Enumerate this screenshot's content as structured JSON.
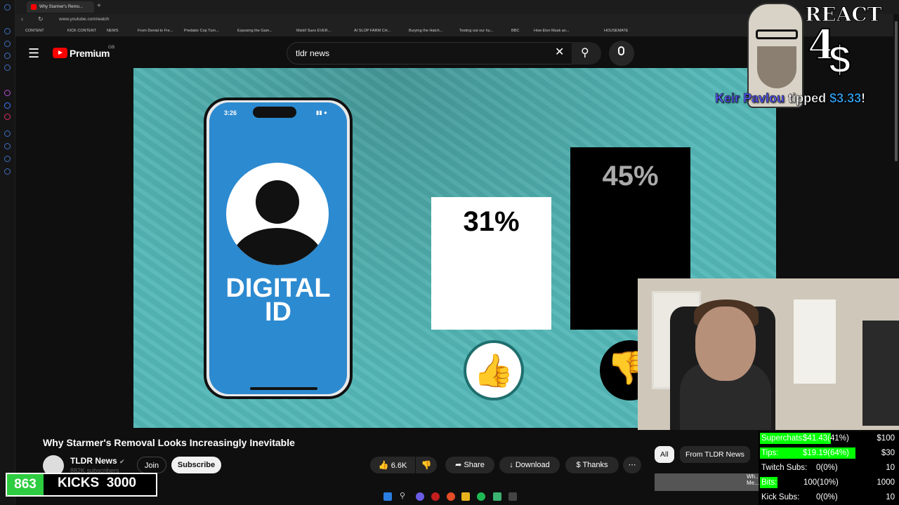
{
  "browser": {
    "tab_title": "Why Starmer's Remo...",
    "url": "www.youtube.com/watch",
    "bookmarks": [
      "CONTENT",
      "KICK CONTENT",
      "NEWS",
      "From Denial to Fre...",
      "Predator Cop Turn...",
      "Exposing the Gam...",
      "Mizkif Sues EVER...",
      "AI SLOP FARM CH...",
      "Burying the Hatch...",
      "Testing out our hu...",
      "BBC",
      "How Elon Musk an...",
      "HOUSEMATE"
    ]
  },
  "youtube": {
    "logo_text": "Premium",
    "logo_region": "GB",
    "search_value": "tldr news",
    "video_title": "Why Starmer's Removal Looks Increasingly Inevitable",
    "channel_name": "TLDR News",
    "subscriber_count": "882K subscribers",
    "join_label": "Join",
    "subscribe_label": "Subscribe",
    "like_count": "6.6K",
    "share_label": "Share",
    "download_label": "Download",
    "thanks_label": "Thanks",
    "chips": [
      "All",
      "From TLDR News",
      "Wh... Me..."
    ]
  },
  "video_frame": {
    "phone_time": "3:26",
    "phone_text": "DIGITAL ID",
    "bar1_label": "31%",
    "bar2_label": "45%"
  },
  "overlay": {
    "react_text": "REACT",
    "react_number": "4",
    "react_symbol": "$",
    "tip_name_1": "Keir",
    "tip_name_2": "Pavlou",
    "tip_action": "tipped",
    "tip_amount": "$3.33",
    "tip_exclaim": "!",
    "kicks_count": "863",
    "kicks_label": "KICKS",
    "kicks_goal": "3000"
  },
  "stats": [
    {
      "label": "Superchats:",
      "value": "$41.43(41%)",
      "goal": "$100",
      "fill_pct": 41,
      "color": "#00ff00"
    },
    {
      "label": "Tips:",
      "value": "$19.19(64%)",
      "goal": "$30",
      "fill_pct": 64,
      "color": "#00ff00"
    },
    {
      "label": "Twitch Subs:",
      "value": "0(0%)",
      "goal": "10",
      "fill_pct": 0,
      "color": "#00ff00"
    },
    {
      "label": "Bits:",
      "value": "100(10%)",
      "goal": "1000",
      "fill_pct": 10,
      "color": "#00ff00"
    },
    {
      "label": "Kick Subs:",
      "value": "0(0%)",
      "goal": "10",
      "fill_pct": 0,
      "color": "#00ff00"
    }
  ],
  "colors": {
    "youtube_red": "#ff0000",
    "video_teal": "#54b8b7",
    "phone_blue": "#2c8ad0",
    "kick_green": "#2ecc40"
  }
}
